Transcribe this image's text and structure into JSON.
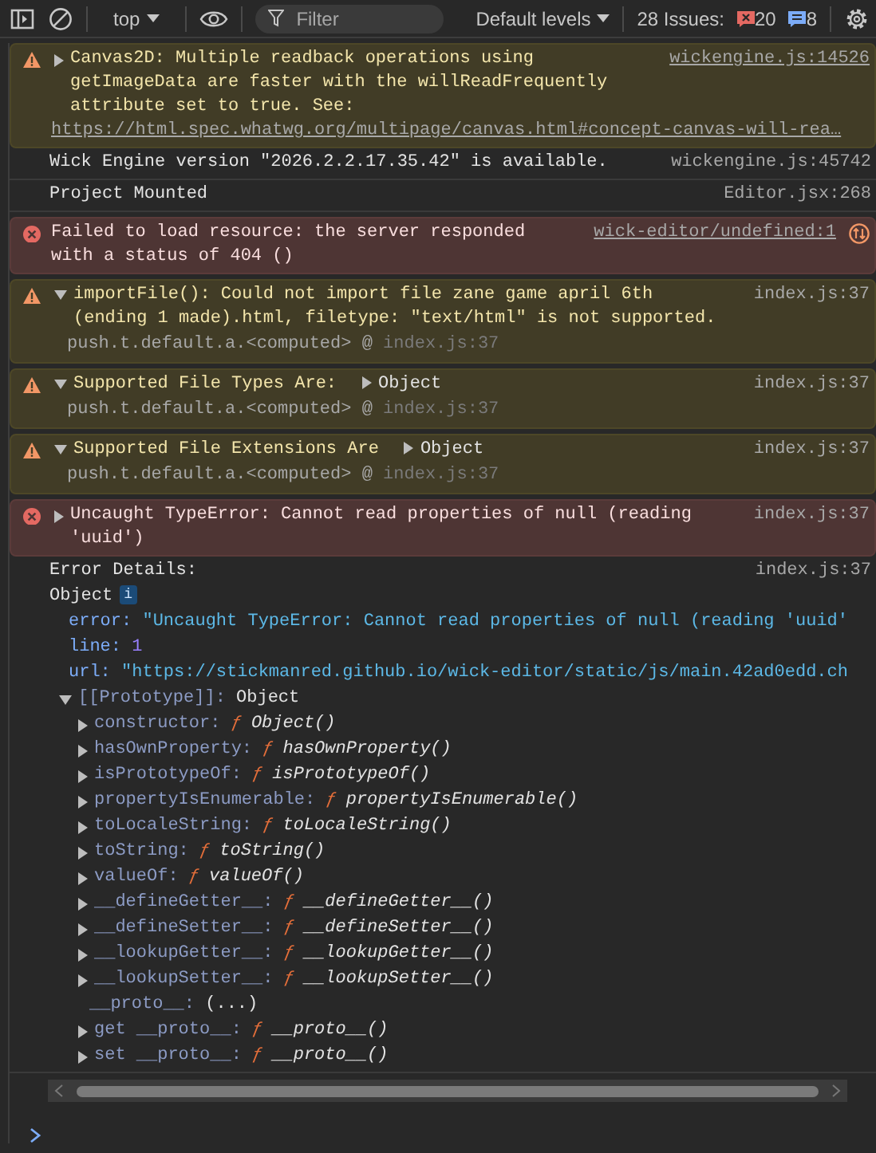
{
  "toolbar": {
    "context": "top",
    "filter_placeholder": "Filter",
    "levels": "Default levels",
    "issues_label": "28 Issues:",
    "error_issues": "20",
    "info_issues": "8"
  },
  "messages": [
    {
      "kind": "warning",
      "expanded": false,
      "text": "Canvas2D: Multiple readback operations using getImageData are faster with the willReadFrequently attribute set to true. See:",
      "link": "https://html.spec.whatwg.org/multipage/canvas.html#concept-canvas-will-rea…",
      "source": "wickengine.js:14526",
      "source_underlined": true
    },
    {
      "kind": "info",
      "text": "Wick Engine version \"2026.2.2.17.35.42\" is available.",
      "source": "wickengine.js:45742",
      "source_underlined": false
    },
    {
      "kind": "info",
      "text": "Project Mounted",
      "source": "Editor.jsx:268",
      "source_underlined": false
    },
    {
      "kind": "error",
      "text": "Failed to load resource: the server responded with a status of 404 ()",
      "source": "wick-editor/undefined:1",
      "source_underlined": true,
      "network_icon": true
    },
    {
      "kind": "warning",
      "expanded": true,
      "text": "importFile(): Could not import file zane game april 6th (ending 1 made).html, filetype: \"text/html\" is not supported.",
      "source": "index.js:37",
      "source_underlined": false,
      "stack": {
        "caller": "push.t.default.a.<computed>",
        "at": "@",
        "location": "index.js:37"
      }
    },
    {
      "kind": "warning",
      "expanded": true,
      "text": "Supported File Types Are:",
      "object_label": "Object",
      "object_expanded": false,
      "source": "index.js:37",
      "source_underlined": false,
      "stack": {
        "caller": "push.t.default.a.<computed>",
        "at": "@",
        "location": "index.js:37"
      }
    },
    {
      "kind": "warning",
      "expanded": true,
      "text": "Supported File Extensions Are",
      "object_label": "Object",
      "object_expanded": false,
      "source": "index.js:37",
      "source_underlined": false,
      "stack": {
        "caller": "push.t.default.a.<computed>",
        "at": "@",
        "location": "index.js:37"
      }
    },
    {
      "kind": "error",
      "expanded": false,
      "text": "Uncaught TypeError: Cannot read properties of null (reading 'uuid')",
      "source": "index.js:37",
      "source_underlined": false
    },
    {
      "kind": "info",
      "text": "Error Details:",
      "source": "index.js:37",
      "source_underlined": false,
      "object": {
        "label": "Object",
        "info_badge": "i",
        "properties": [
          {
            "key": "error:",
            "value": "\"Uncaught TypeError: Cannot read properties of null (reading 'uuid'",
            "kind": "string"
          },
          {
            "key": "line:",
            "value": "1",
            "kind": "number"
          },
          {
            "key": "url:",
            "value": "\"https://stickmanred.github.io/wick-editor/static/js/main.42ad0edd.ch",
            "kind": "string"
          }
        ],
        "prototype": {
          "key": "[[Prototype]]:",
          "value": "Object",
          "expanded": true,
          "members": [
            {
              "key": "constructor:",
              "prefix": "ƒ",
              "value": "Object()",
              "expanded": false
            },
            {
              "key": "hasOwnProperty:",
              "prefix": "ƒ",
              "value": "hasOwnProperty()",
              "expanded": false
            },
            {
              "key": "isPrototypeOf:",
              "prefix": "ƒ",
              "value": "isPrototypeOf()",
              "expanded": false
            },
            {
              "key": "propertyIsEnumerable:",
              "prefix": "ƒ",
              "value": "propertyIsEnumerable()",
              "expanded": false
            },
            {
              "key": "toLocaleString:",
              "prefix": "ƒ",
              "value": "toLocaleString()",
              "expanded": false
            },
            {
              "key": "toString:",
              "prefix": "ƒ",
              "value": "toString()",
              "expanded": false
            },
            {
              "key": "valueOf:",
              "prefix": "ƒ",
              "value": "valueOf()",
              "expanded": false
            },
            {
              "key": "__defineGetter__:",
              "prefix": "ƒ",
              "value": "__defineGetter__()",
              "expanded": false
            },
            {
              "key": "__defineSetter__:",
              "prefix": "ƒ",
              "value": "__defineSetter__()",
              "expanded": false
            },
            {
              "key": "__lookupGetter__:",
              "prefix": "ƒ",
              "value": "__lookupGetter__()",
              "expanded": false
            },
            {
              "key": "__lookupSetter__:",
              "prefix": "ƒ",
              "value": "__lookupSetter__()",
              "expanded": false
            },
            {
              "key": "__proto__:",
              "value": "(...)"
            },
            {
              "key": "get __proto__:",
              "prefix": "ƒ",
              "value": "__proto__()",
              "expanded": false
            },
            {
              "key": "set __proto__:",
              "prefix": "ƒ",
              "value": "__proto__()",
              "expanded": false
            }
          ]
        }
      }
    }
  ]
}
